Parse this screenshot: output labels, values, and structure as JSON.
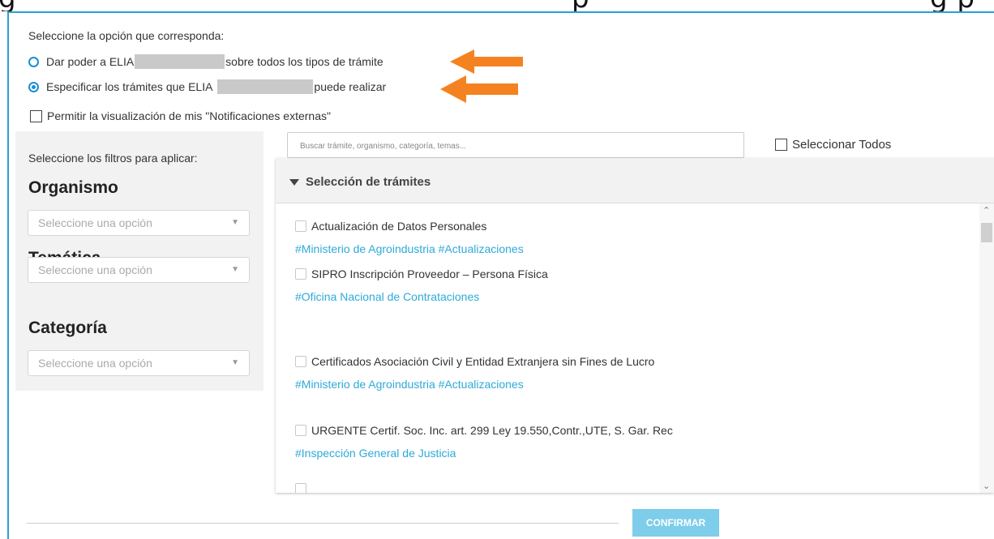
{
  "header_crop": {
    "left": "g",
    "mid": "p",
    "right": "g p"
  },
  "prompt": "Seleccione la opción que corresponda:",
  "options": [
    {
      "prefix": "Dar poder a ELIA",
      "suffix": "sobre todos los tipos de trámite",
      "selected": false
    },
    {
      "prefix": "Especificar los trámites que ELIA",
      "suffix": "puede realizar",
      "selected": true
    }
  ],
  "notifications_checkbox": {
    "label": "Permitir la visualización de mis \"Notificaciones externas\"",
    "checked": false
  },
  "filters": {
    "hint": "Seleccione los filtros para aplicar:",
    "groups": [
      {
        "title": "Organismo",
        "placeholder": "Seleccione una opción"
      },
      {
        "title": "Temática",
        "placeholder": "Seleccione una opción"
      },
      {
        "title": "Categoría",
        "placeholder": "Seleccione una opción"
      }
    ]
  },
  "search": {
    "placeholder": "Buscar trámite, organismo, categoría, temas..."
  },
  "select_all": {
    "label": "Seleccionar Todos",
    "checked": false
  },
  "list": {
    "title": "Selección de trámites",
    "items": [
      {
        "title": "Actualización de Datos Personales",
        "tags": "#Ministerio de Agroindustria #Actualizaciones"
      },
      {
        "title": "SIPRO Inscripción Proveedor – Persona Física",
        "tags": "#Oficina Nacional de Contrataciones"
      },
      {
        "title": "Certificados Asociación Civil y Entidad Extranjera sin Fines de Lucro",
        "tags": "#Ministerio de Agroindustria #Actualizaciones"
      },
      {
        "title": "URGENTE Certif. Soc. Inc. art. 299 Ley 19.550,Contr.,UTE, S. Gar. Rec",
        "tags": "#Inspección General de Justicia"
      }
    ]
  },
  "confirm_label": "CONFIRMAR",
  "colors": {
    "accent": "#2eaad8",
    "arrow": "#f58220",
    "confirm": "#7ecdea"
  },
  "icons": {
    "caret": "chevron-down-icon",
    "arrow": "arrow-left-icon"
  }
}
